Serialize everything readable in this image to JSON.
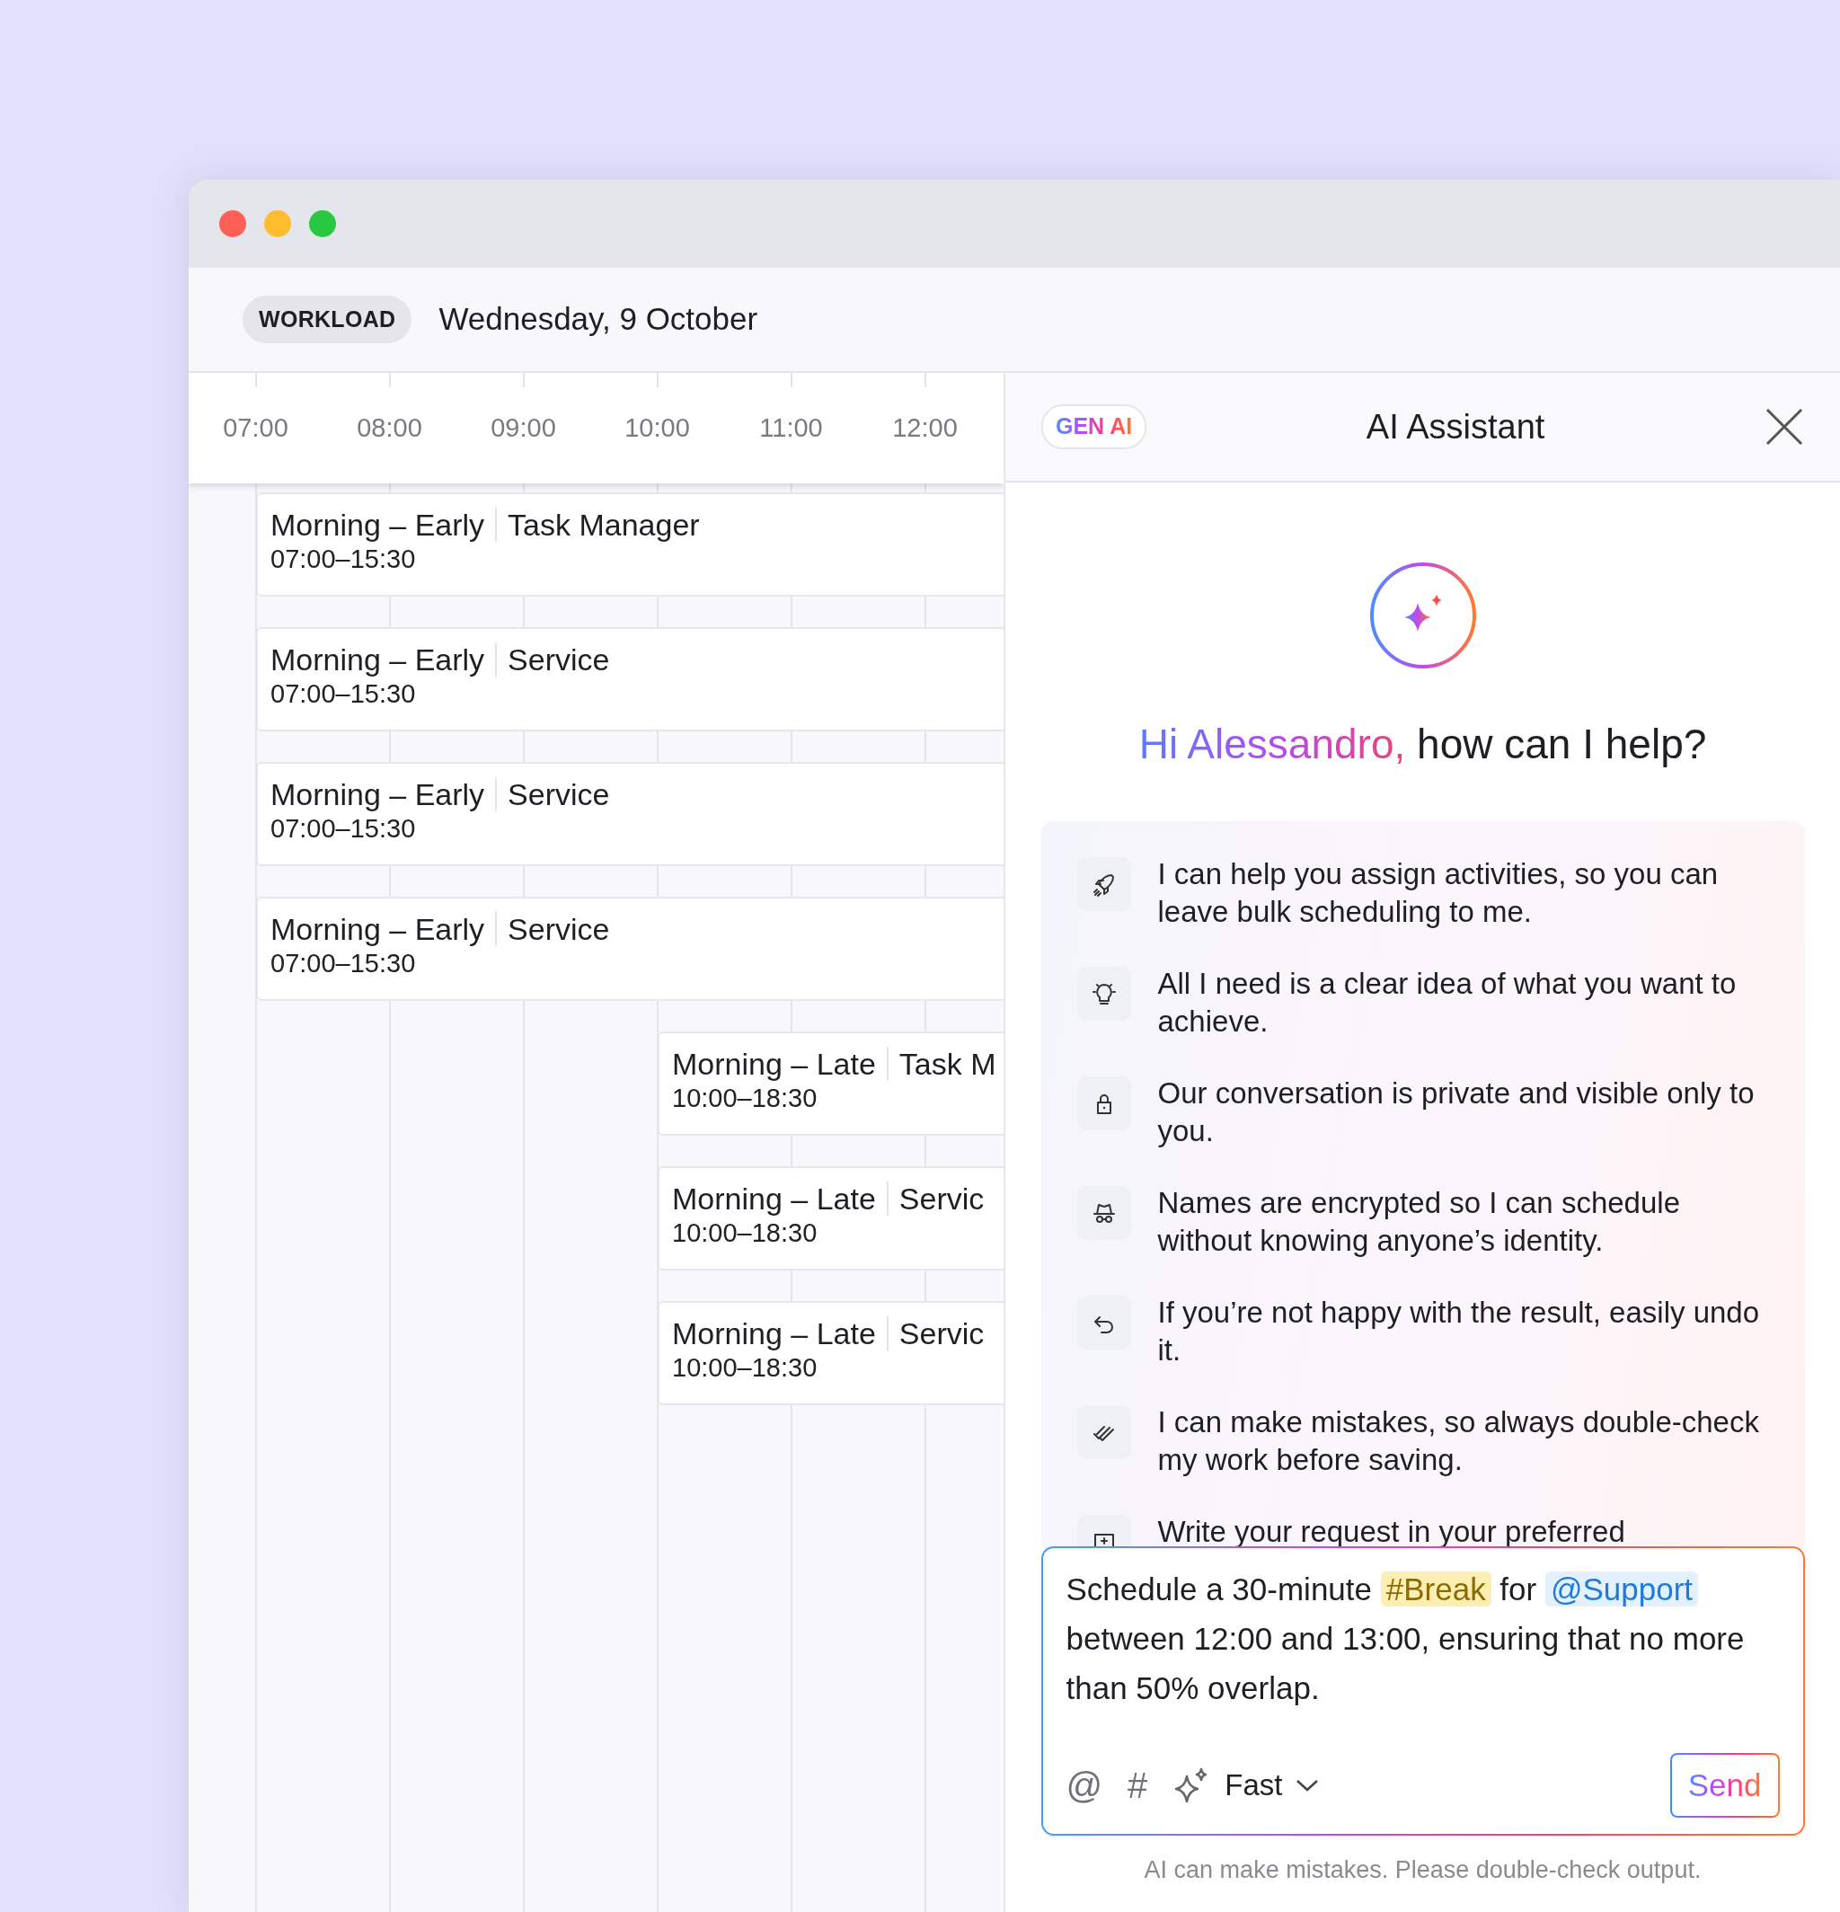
{
  "window": {
    "controls": [
      {
        "color": "#fe5f57"
      },
      {
        "color": "#febc2e"
      },
      {
        "color": "#28c840"
      }
    ]
  },
  "header": {
    "badge": "WORKLOAD",
    "date": "Wednesday, 9 October"
  },
  "timeline": {
    "hours": [
      "07:00",
      "08:00",
      "09:00",
      "10:00",
      "11:00",
      "12:00"
    ],
    "shifts": [
      {
        "kind": "early",
        "name": "Morning – Early",
        "role": "Task Manager",
        "time": "07:00–15:30"
      },
      {
        "kind": "early",
        "name": "Morning – Early",
        "role": "Service",
        "time": "07:00–15:30"
      },
      {
        "kind": "early",
        "name": "Morning – Early",
        "role": "Service",
        "time": "07:00–15:30"
      },
      {
        "kind": "early",
        "name": "Morning – Early",
        "role": "Service",
        "time": "07:00–15:30"
      },
      {
        "kind": "late",
        "name": "Morning – Late",
        "role": "Task M",
        "time": "10:00–18:30"
      },
      {
        "kind": "late",
        "name": "Morning – Late",
        "role": "Servic",
        "time": "10:00–18:30"
      },
      {
        "kind": "late",
        "name": "Morning – Late",
        "role": "Servic",
        "time": "10:00–18:30"
      }
    ]
  },
  "assistant": {
    "badge": "GEN AI",
    "title": "AI Assistant",
    "greeting": {
      "name": "Hi Alessandro,",
      "question": "how can I help?"
    },
    "tips": [
      "I can help you assign activities, so you can leave bulk scheduling to me.",
      "All I need is a clear idea of what you want to achieve.",
      "Our conversation is private and visible only to you.",
      "Names are encrypted so I can schedule without knowing anyone’s identity.",
      "If you’re not happy with the result, easily undo it.",
      "I can make mistakes, so always double-check my work before saving.",
      "Write your request in your preferred"
    ],
    "prompt": [
      {
        "kind": "text",
        "text": "Schedule a 30-minute "
      },
      {
        "kind": "tag",
        "text": "#Break"
      },
      {
        "kind": "text",
        "text": " for "
      },
      {
        "kind": "mention",
        "text": "@Support"
      },
      {
        "kind": "text",
        "text": " between 12:00 and 13:00, ensuring that no more than 50% overlap."
      }
    ],
    "toolbar": {
      "mention": "@",
      "tag": "#",
      "model": "Fast",
      "send": "Send"
    },
    "disclaimer": "AI can make mistakes. Please double-check output."
  }
}
